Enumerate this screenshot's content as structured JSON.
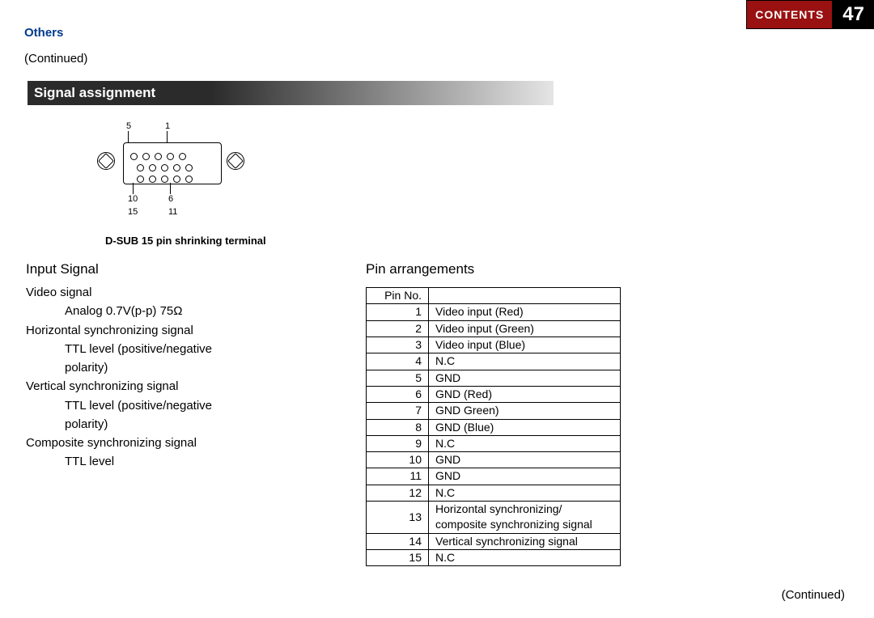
{
  "header": {
    "others": "Others",
    "continued_top": "(Continued)",
    "contents": "CONTENTS",
    "page_number": "47"
  },
  "section": {
    "title": "Signal assignment",
    "caption": "D-SUB 15 pin shrinking terminal"
  },
  "diagram_pin_labels": {
    "p5": "5",
    "p1": "1",
    "p10": "10",
    "p6": "6",
    "p15": "15",
    "p11": "11"
  },
  "input_signal": {
    "heading": "Input Signal",
    "items": {
      "video": "Video signal",
      "video_sub": "Analog 0.7V(p-p)   75Ω",
      "hsync": "Horizontal synchronizing signal",
      "hsync_sub": "TTL level (positive/negative polarity)",
      "vsync": "Vertical synchronizing signal",
      "vsync_sub": "TTL level  (positive/negative polarity)",
      "csync": "Composite synchronizing signal",
      "csync_sub": "TTL level"
    }
  },
  "pin_arrangements": {
    "heading": "Pin arrangements",
    "col_pin": "Pin No.",
    "rows": {
      "r1n": "1",
      "r1d": "Video input (Red)",
      "r2n": "2",
      "r2d": "Video input (Green)",
      "r3n": "3",
      "r3d": "Video input (Blue)",
      "r4n": "4",
      "r4d": "N.C",
      "r5n": "5",
      "r5d": "GND",
      "r6n": "6",
      "r6d": "GND (Red)",
      "r7n": "7",
      "r7d": "GND Green)",
      "r8n": "8",
      "r8d": "GND (Blue)",
      "r9n": "9",
      "r9d": "N.C",
      "r10n": "10",
      "r10d": "GND",
      "r11n": "11",
      "r11d": "GND",
      "r12n": "12",
      "r12d": "N.C",
      "r13n": "13",
      "r13d": "Horizontal synchronizing/ composite synchronizing signal",
      "r14n": "14",
      "r14d": "Vertical synchronizing signal",
      "r15n": "15",
      "r15d": "N.C"
    }
  },
  "footer": {
    "continued_bottom": "(Continued)"
  }
}
